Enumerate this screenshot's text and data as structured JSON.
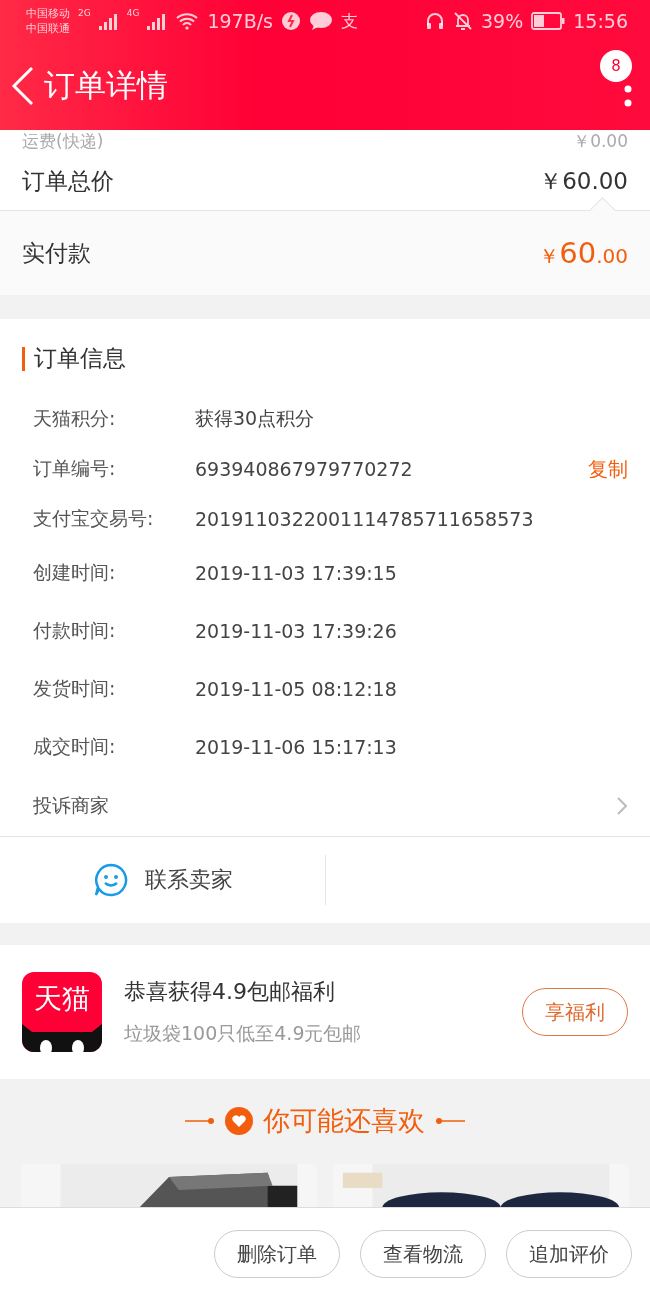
{
  "status_bar": {
    "carriers": [
      "中国移动",
      "中国联通"
    ],
    "networks": [
      "2G",
      "4G"
    ],
    "speed": "197B/s",
    "app_glyph": "支",
    "battery_text": "39%",
    "time": "15:56"
  },
  "header": {
    "title": "订单详情",
    "badge": "8"
  },
  "price_rows": [
    {
      "label": "运费(快递)",
      "value": "￥0.00",
      "kind": "faded"
    },
    {
      "label": "订单总价",
      "value": "￥60.00",
      "kind": "normal"
    }
  ],
  "paid": {
    "label": "实付款",
    "currency": "￥",
    "integer": "60",
    "decimal": ".00"
  },
  "order_info": {
    "title": "订单信息",
    "rows": [
      {
        "label": "天猫积分:",
        "value": "获得30点积分"
      },
      {
        "label": "订单编号:",
        "value": "693940867979770272",
        "action": "复制"
      },
      {
        "label": "支付宝交易号:",
        "value": "2019110322001114785711658573"
      },
      {
        "label": "创建时间:",
        "value": "2019-11-03 17:39:15"
      },
      {
        "label": "付款时间:",
        "value": "2019-11-03 17:39:26"
      },
      {
        "label": "发货时间:",
        "value": "2019-11-05 08:12:18"
      },
      {
        "label": "成交时间:",
        "value": "2019-11-06 15:17:13"
      }
    ],
    "complaint": "投诉商家",
    "contact": "联系卖家"
  },
  "promo": {
    "logo": "天猫",
    "title": "恭喜获得4.9包邮福利",
    "subtitle": "垃圾袋100只低至4.9元包邮",
    "button": "享福利"
  },
  "recommend": {
    "title": "你可能还喜欢"
  },
  "actions": [
    "删除订单",
    "查看物流",
    "追加评价"
  ]
}
